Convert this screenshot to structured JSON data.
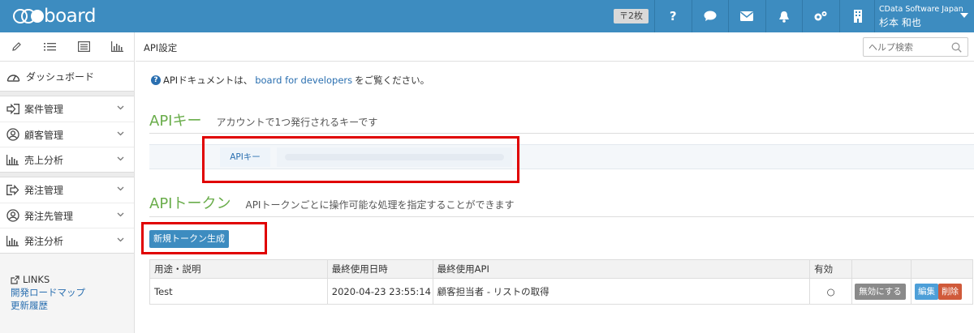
{
  "header": {
    "logo_text": "board",
    "quota": "〒2枚",
    "icons": [
      "help-icon",
      "chat-icon",
      "mail-icon",
      "bell-icon",
      "gears-icon",
      "building-icon"
    ],
    "help_glyph": "?",
    "account": {
      "company": "CData Software Japan",
      "username": "杉本 和也"
    }
  },
  "sidebar": {
    "tools": [
      "pencil-icon",
      "list-icon",
      "report-icon",
      "bar-chart-icon"
    ],
    "dashboard": "ダッシュボード",
    "group1": [
      {
        "label": "案件管理",
        "icon": "import-icon"
      },
      {
        "label": "顧客管理",
        "icon": "person-icon"
      },
      {
        "label": "売上分析",
        "icon": "bar-chart-icon"
      }
    ],
    "group2": [
      {
        "label": "発注管理",
        "icon": "export-icon"
      },
      {
        "label": "発注先管理",
        "icon": "person-icon"
      },
      {
        "label": "発注分析",
        "icon": "bar-chart-icon"
      }
    ],
    "links_title": "LINKS",
    "links": [
      "開発ロードマップ",
      "更新履歴"
    ]
  },
  "main": {
    "page_title": "API設定",
    "help_search_placeholder": "ヘルプ検索",
    "notice": {
      "prefix": "APIドキュメントは、",
      "link": "board for developers",
      "suffix": "をご覧ください。"
    },
    "api_key": {
      "title": "APIキー",
      "subtitle": "アカウントで1つ発行されるキーです",
      "label": "APIキー",
      "value": ""
    },
    "api_token": {
      "title": "APIトークン",
      "subtitle": "APIトークンごとに操作可能な処理を指定することができます",
      "generate_button": "新規トークン生成"
    },
    "table": {
      "headers": [
        "用途・説明",
        "最終使用日時",
        "最終使用API",
        "有効",
        "",
        ""
      ],
      "rows": [
        {
          "purpose": "Test",
          "last_used": "2020-04-23 23:55:14",
          "last_api": "顧客担当者 - リストの取得",
          "valid": "○",
          "disable_label": "無効にする",
          "edit_label": "編集",
          "delete_label": "削除"
        }
      ]
    }
  },
  "colors": {
    "header": "#3d8cc0",
    "section_title": "#6aad4b",
    "highlight": "#e00000",
    "link": "#2a6fb0"
  }
}
